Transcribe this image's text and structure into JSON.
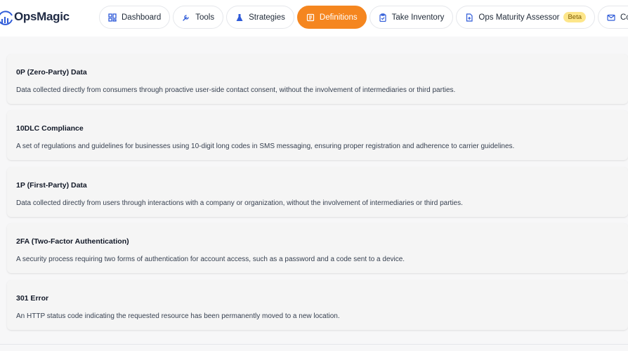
{
  "brand": {
    "name": "OpsMagic",
    "accent": "#f5861f"
  },
  "nav": [
    {
      "key": "dashboard",
      "label": "Dashboard",
      "icon": "grid-icon"
    },
    {
      "key": "tools",
      "label": "Tools",
      "icon": "wrench-icon"
    },
    {
      "key": "strategies",
      "label": "Strategies",
      "icon": "flask-icon"
    },
    {
      "key": "definitions",
      "label": "Definitions",
      "icon": "book-icon",
      "active": true
    },
    {
      "key": "take-inventory",
      "label": "Take Inventory",
      "icon": "clipboard-icon"
    },
    {
      "key": "ops-maturity",
      "label": "Ops Maturity Assessor",
      "icon": "document-icon",
      "badge": "Beta"
    },
    {
      "key": "contact",
      "label": "Contact",
      "icon": "mail-icon"
    }
  ],
  "definitions": [
    {
      "term": "0P (Zero-Party) Data",
      "definition": "Data collected directly from consumers through proactive user-side contact consent, without the involvement of intermediaries or third parties."
    },
    {
      "term": "10DLC Compliance",
      "definition": "A set of regulations and guidelines for businesses using 10-digit long codes in SMS messaging, ensuring proper registration and adherence to carrier guidelines."
    },
    {
      "term": "1P (First-Party) Data",
      "definition": "Data collected directly from users through interactions with a company or organization, without the involvement of intermediaries or third parties."
    },
    {
      "term": "2FA (Two-Factor Authentication)",
      "definition": "A security process requiring two forms of authentication for account access, such as a password and a code sent to a device."
    },
    {
      "term": "301 Error",
      "definition": "An HTTP status code indicating the requested resource has been permanently moved to a new location."
    }
  ]
}
